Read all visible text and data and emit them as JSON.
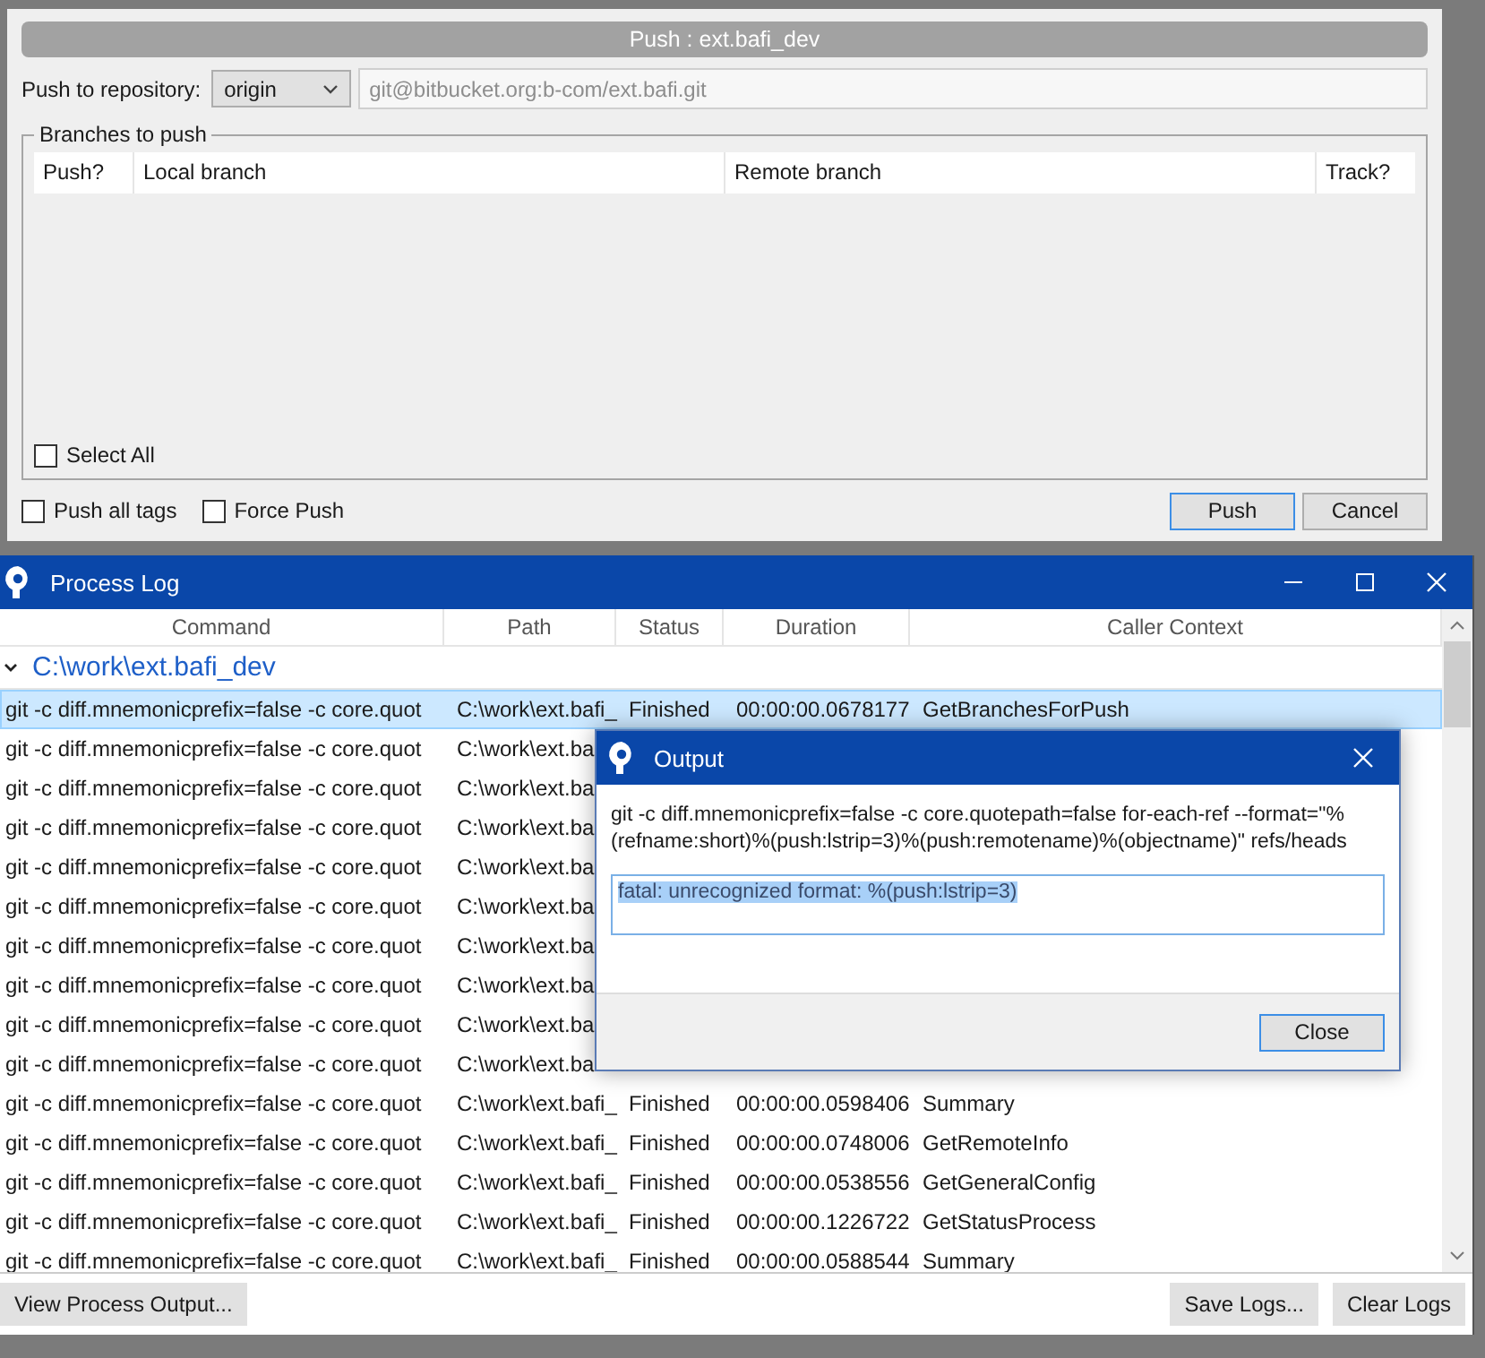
{
  "push_dialog": {
    "title": "Push :  ext.bafi_dev",
    "repository_label": "Push to repository:",
    "remote": "origin",
    "url": "git@bitbucket.org:b-com/ext.bafi.git",
    "group_title": "Branches to push",
    "columns": [
      "Push?",
      "Local branch",
      "Remote branch",
      "Track?"
    ],
    "select_all": {
      "label": "Select All",
      "checked": false
    },
    "options": [
      {
        "label": "Push all tags",
        "checked": false
      },
      {
        "label": "Force Push",
        "checked": false
      }
    ],
    "buttons": [
      {
        "label": "Push",
        "focused": true
      },
      {
        "label": "Cancel",
        "focused": false
      }
    ]
  },
  "process_log": {
    "title": "Process Log",
    "columns": [
      "Command",
      "Path",
      "Status",
      "Duration",
      "Caller Context"
    ],
    "group": {
      "label": "C:\\work\\ext.bafi_dev",
      "expanded": true
    },
    "rows": [
      {
        "command": "git -c diff.mnemonicprefix=false -c core.quot",
        "path": "C:\\work\\ext.bafi_",
        "status": "Finished",
        "duration": "00:00:00.0678177",
        "context": "GetBranchesForPush",
        "selected": true
      },
      {
        "command": "git -c diff.mnemonicprefix=false -c core.quot",
        "path": "C:\\work\\ext.ba",
        "selected": false
      },
      {
        "command": "git -c diff.mnemonicprefix=false -c core.quot",
        "path": "C:\\work\\ext.ba",
        "selected": false
      },
      {
        "command": "git -c diff.mnemonicprefix=false -c core.quot",
        "path": "C:\\work\\ext.ba",
        "selected": false
      },
      {
        "command": "git -c diff.mnemonicprefix=false -c core.quot",
        "path": "C:\\work\\ext.ba",
        "selected": false
      },
      {
        "command": "git -c diff.mnemonicprefix=false -c core.quot",
        "path": "C:\\work\\ext.ba",
        "selected": false
      },
      {
        "command": "git -c diff.mnemonicprefix=false -c core.quot",
        "path": "C:\\work\\ext.ba",
        "selected": false
      },
      {
        "command": "git -c diff.mnemonicprefix=false -c core.quot",
        "path": "C:\\work\\ext.ba",
        "selected": false
      },
      {
        "command": "git -c diff.mnemonicprefix=false -c core.quot",
        "path": "C:\\work\\ext.ba",
        "selected": false
      },
      {
        "command": "git -c diff.mnemonicprefix=false -c core.quot",
        "path": "C:\\work\\ext.ba",
        "selected": false
      },
      {
        "command": "git -c diff.mnemonicprefix=false -c core.quot",
        "path": "C:\\work\\ext.bafi_",
        "status": "Finished",
        "duration": "00:00:00.0598406",
        "context": "Summary",
        "selected": false
      },
      {
        "command": "git -c diff.mnemonicprefix=false -c core.quot",
        "path": "C:\\work\\ext.bafi_",
        "status": "Finished",
        "duration": "00:00:00.0748006",
        "context": "GetRemoteInfo",
        "selected": false
      },
      {
        "command": "git -c diff.mnemonicprefix=false -c core.quot",
        "path": "C:\\work\\ext.bafi_",
        "status": "Finished",
        "duration": "00:00:00.0538556",
        "context": "GetGeneralConfig",
        "selected": false
      },
      {
        "command": "git -c diff.mnemonicprefix=false -c core.quot",
        "path": "C:\\work\\ext.bafi_",
        "status": "Finished",
        "duration": "00:00:00.1226722",
        "context": "GetStatusProcess",
        "selected": false
      },
      {
        "command": "git -c diff.mnemonicprefix=false -c core.quot",
        "path": "C:\\work\\ext.bafi_",
        "status": "Finished",
        "duration": "00:00:00.0588544",
        "context": "Summary",
        "selected": false
      }
    ],
    "buttons_left": [
      "View Process Output..."
    ],
    "buttons_right": [
      "Save Logs...",
      "Clear Logs"
    ]
  },
  "output_dialog": {
    "title": "Output",
    "command": "git -c diff.mnemonicprefix=false -c core.quotepath=false for-each-ref --format=\"%(refname:short)%(push:lstrip=3)%(push:remotename)%(objectname)\" refs/heads",
    "output": "fatal: unrecognized format: %(push:lstrip=3)",
    "button": "Close"
  }
}
